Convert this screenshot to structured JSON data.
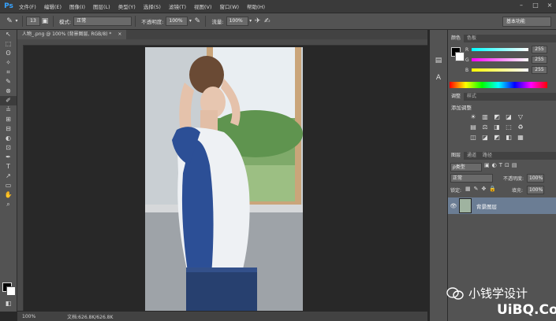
{
  "app": {
    "logo": "Ps"
  },
  "menu": [
    "文件(F)",
    "编辑(E)",
    "图像(I)",
    "图层(L)",
    "类型(Y)",
    "选择(S)",
    "滤镜(T)",
    "视图(V)",
    "窗口(W)",
    "帮助(H)"
  ],
  "window_controls": [
    "–",
    "□",
    "×"
  ],
  "options": {
    "brush_size": "13",
    "mode_label": "模式:",
    "mode_value": "正常",
    "opacity_label": "不透明度:",
    "opacity_value": "100%",
    "flow_label": "流量:",
    "flow_value": "100%",
    "workspace": "基本功能"
  },
  "document": {
    "tab_title": "人物_.png @ 100% (背景图层, RGB/8) *",
    "tab_close": "×",
    "zoom": "100%",
    "doc_size": "文档:626.8K/626.8K"
  },
  "tools": [
    "↖",
    "⬚",
    "ʘ",
    "✧",
    "⌗",
    "✎",
    "⊗",
    "✐",
    "≟",
    "⊞",
    "⊟",
    "◐",
    "⊡",
    "✒",
    "T",
    "↗",
    "▭",
    "✋",
    "⌕",
    "◧",
    "⬒"
  ],
  "color_panel": {
    "tabs": [
      "颜色",
      "色板"
    ],
    "channels": [
      {
        "label": "R",
        "value": "255"
      },
      {
        "label": "G",
        "value": "255"
      },
      {
        "label": "B",
        "value": "255"
      }
    ]
  },
  "adjust_panel": {
    "tabs": [
      "调整",
      "样式"
    ],
    "title": "添加调整",
    "icons": [
      "☀",
      "▥",
      "◩",
      "◪",
      "▽",
      "",
      "▤",
      "⚖",
      "◨",
      "⬚",
      "♻",
      "",
      "◫",
      "◪",
      "◩",
      "◧",
      "▦",
      ""
    ]
  },
  "layers_panel": {
    "tabs": [
      "图层",
      "通道",
      "路径"
    ],
    "filter_value": "ρ类型",
    "blend_value": "正常",
    "opacity_label": "不透明度:",
    "opacity_value": "100%",
    "lock_label": "锁定:",
    "fill_label": "填充:",
    "fill_value": "100%",
    "layer_name": "背景图层"
  },
  "watermark": {
    "line1": "小钱学设计",
    "line2": "UiBQ.CoM"
  },
  "colors": {
    "accent": "#36a3ff",
    "layer_selected": "#6b7d94"
  }
}
